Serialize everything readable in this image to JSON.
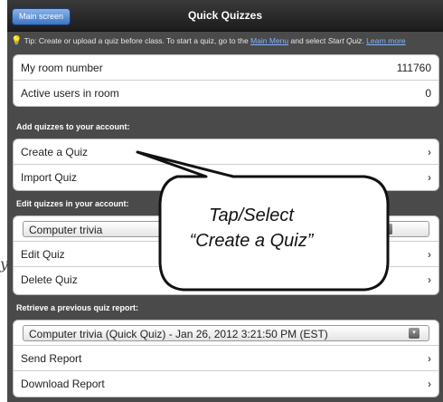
{
  "navbar": {
    "back_label": "Main screen",
    "title": "Quick Quizzes"
  },
  "tip": {
    "prefix": "Tip: Create or upload a quiz before class. To start a quiz, go to the ",
    "link_main_menu": "Main Menu",
    "middle": " and select ",
    "start_quiz": "Start Quiz",
    "suffix": ". ",
    "learn_more": "Learn more",
    "icon": "lightbulb-icon"
  },
  "room": {
    "room_number_label": "My room number",
    "room_number_value": "111760",
    "active_users_label": "Active users in room",
    "active_users_value": "0"
  },
  "add_section": {
    "header": "Add quizzes to your account:",
    "create": "Create a Quiz",
    "import": "Import Quiz"
  },
  "edit_section": {
    "header": "Edit quizzes in your account:",
    "selected_quiz": "Computer trivia",
    "edit": "Edit Quiz",
    "delete": "Delete Quiz"
  },
  "report_section": {
    "header": "Retrieve a previous quiz report:",
    "selected_report": "Computer trivia (Quick Quiz) - Jan 26, 2012 3:21:50 PM (EST)",
    "send": "Send Report",
    "download": "Download Report"
  },
  "callout": {
    "line1": "Tap/Select",
    "line2": "“Create a Quiz”"
  },
  "outside_glyph": "y",
  "colors": {
    "panel_bg": "#4a4a4a",
    "link": "#7fb5ff",
    "back_button": "#3b74c4"
  }
}
